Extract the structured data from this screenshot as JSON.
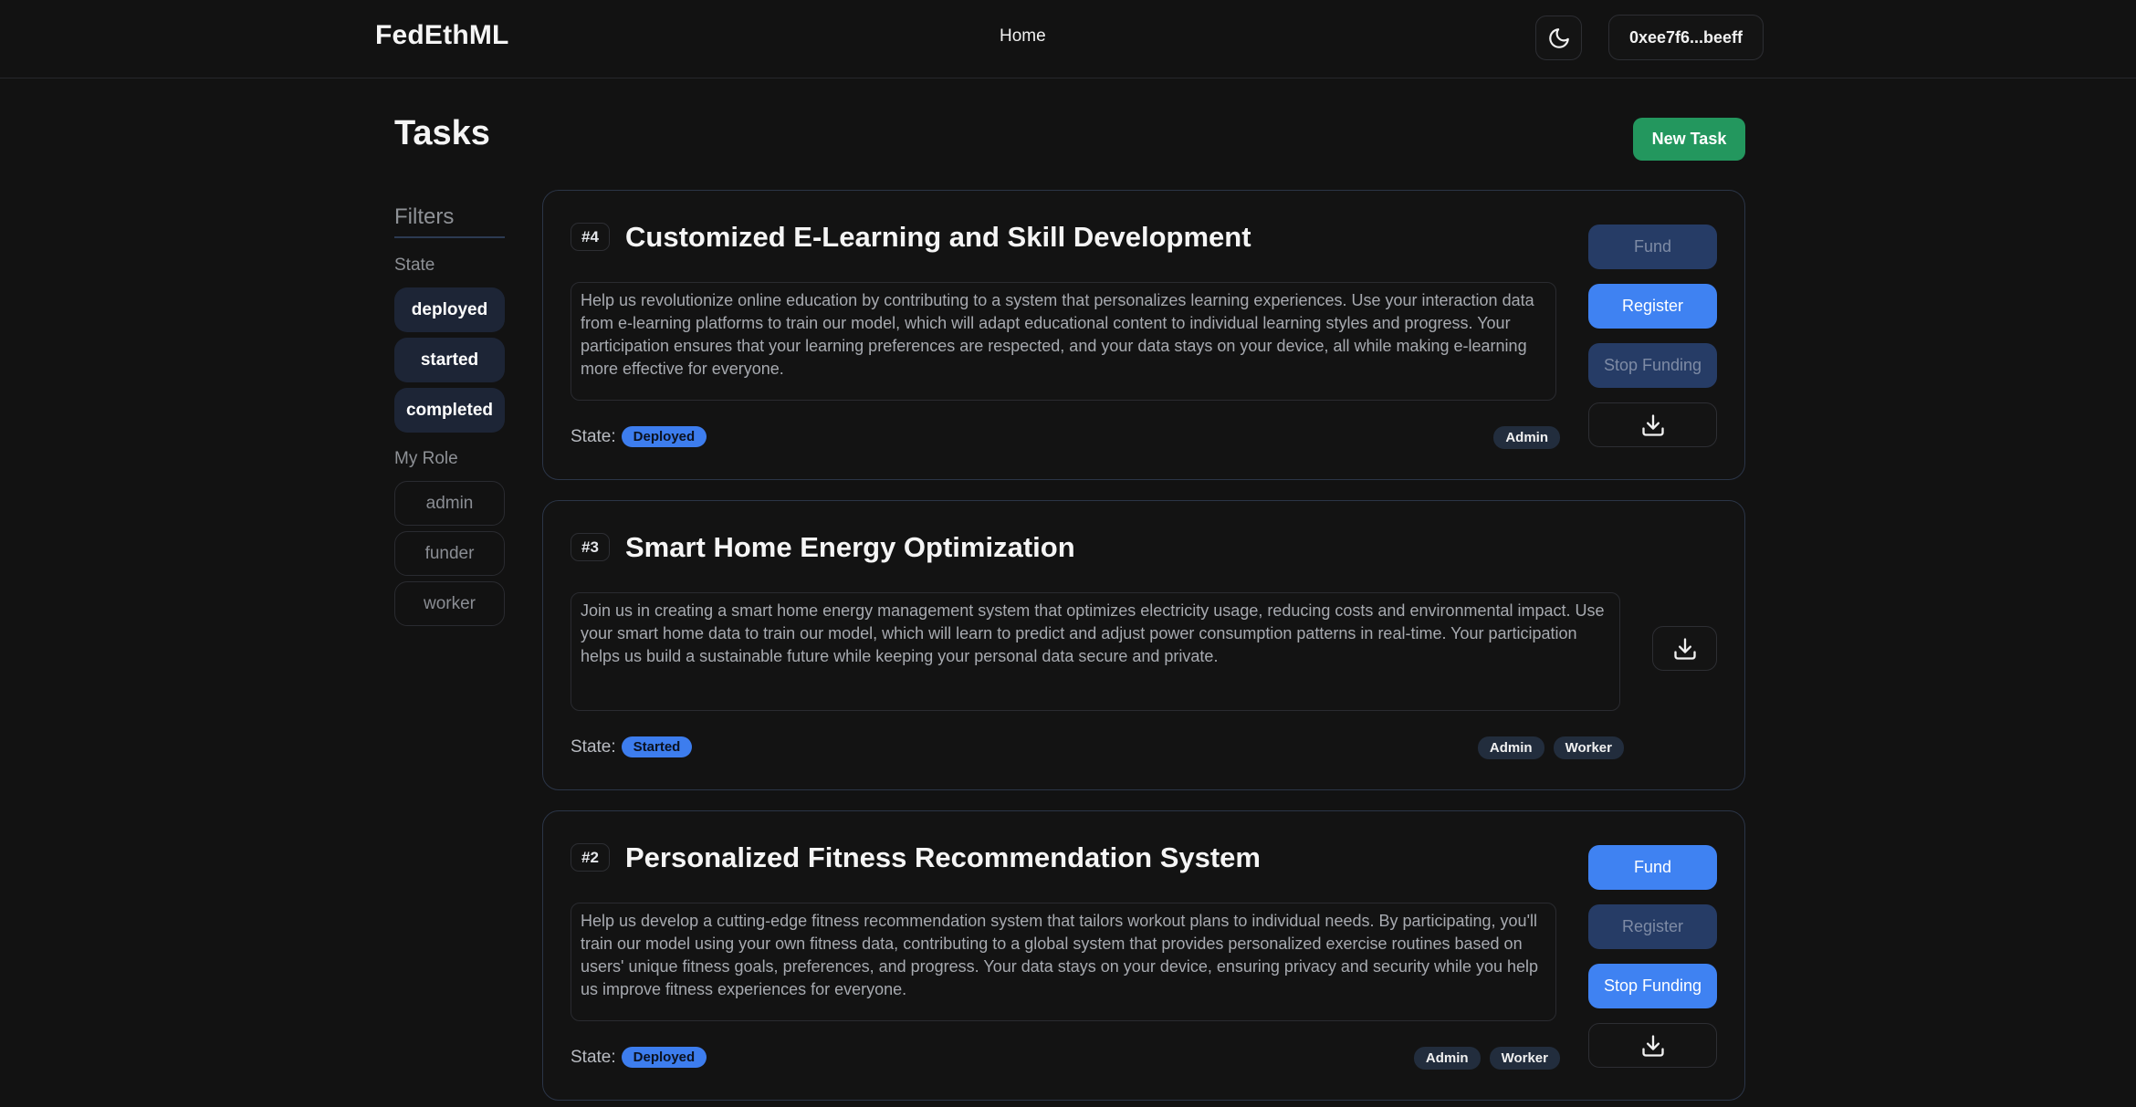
{
  "navbar": {
    "brand": "FedEthML",
    "home_link": "Home",
    "theme_icon": "moon-icon",
    "wallet_address": "0xee7f6...beeff"
  },
  "page": {
    "title": "Tasks",
    "new_task_label": "New Task"
  },
  "filters": {
    "title": "Filters",
    "state_label": "State",
    "states": [
      "deployed",
      "started",
      "completed"
    ],
    "role_label": "My Role",
    "roles": [
      "admin",
      "funder",
      "worker"
    ]
  },
  "tasks": [
    {
      "id": "#4",
      "title": "Customized E-Learning and Skill Development",
      "description": "Help us revolutionize online education by contributing to a system that personalizes learning experiences. Use your interaction data from e-learning platforms to train our model, which will adapt educational content to individual learning styles and progress. Your participation ensures that your learning preferences are respected, and your data stays on your device, all while making e-learning more effective for everyone.",
      "state_label": "State:",
      "state": "Deployed",
      "roles": [
        "Admin"
      ],
      "actions": {
        "fund": "Fund",
        "register": "Register",
        "stop_funding": "Stop Funding",
        "download_icon": "download-icon"
      }
    },
    {
      "id": "#3",
      "title": "Smart Home Energy Optimization",
      "description": "Join us in creating a smart home energy management system that optimizes electricity usage, reducing costs and environmental impact. Use your smart home data to train our model, which will learn to predict and adjust power consumption patterns in real-time. Your participation helps us build a sustainable future while keeping your personal data secure and private.",
      "state_label": "State:",
      "state": "Started",
      "roles": [
        "Admin",
        "Worker"
      ],
      "actions": {
        "download_icon": "download-icon"
      }
    },
    {
      "id": "#2",
      "title": "Personalized Fitness Recommendation System",
      "description": "Help us develop a cutting-edge fitness recommendation system that tailors workout plans to individual needs. By participating, you'll train our model using your own fitness data, contributing to a global system that provides personalized exercise routines based on users' unique fitness goals, preferences, and progress. Your data stays on your device, ensuring privacy and security while you help us improve fitness experiences for everyone.",
      "state_label": "State:",
      "state": "Deployed",
      "roles": [
        "Admin",
        "Worker"
      ],
      "actions": {
        "fund": "Fund",
        "register": "Register",
        "stop_funding": "Stop Funding",
        "download_icon": "download-icon"
      }
    }
  ],
  "colors": {
    "background": "#121212",
    "accent_blue": "#3f82f2",
    "accent_green": "#23975e",
    "disabled_blue": "#263c66"
  }
}
